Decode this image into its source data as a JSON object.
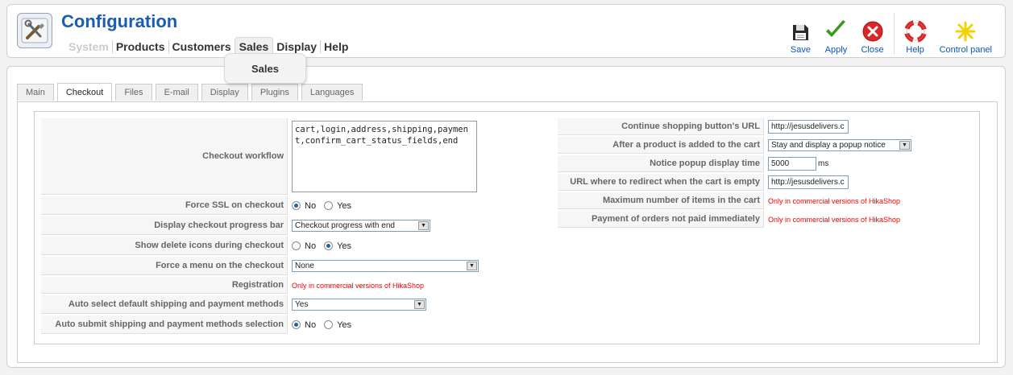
{
  "header": {
    "title": "Configuration",
    "menu": [
      {
        "label": "System",
        "state": "disabled"
      },
      {
        "label": "Products"
      },
      {
        "label": "Customers"
      },
      {
        "label": "Sales",
        "state": "active"
      },
      {
        "label": "Display"
      },
      {
        "label": "Help"
      }
    ],
    "dropdown_item": "Sales"
  },
  "toolbar": {
    "save": "Save",
    "apply": "Apply",
    "close": "Close",
    "help": "Help",
    "control_panel": "Control panel"
  },
  "tabs": [
    "Main",
    "Checkout",
    "Files",
    "E-mail",
    "Display",
    "Plugins",
    "Languages"
  ],
  "active_tab": "Checkout",
  "left_fields": {
    "checkout_workflow": {
      "label": "Checkout workflow",
      "value": "cart,login,address,shipping,payment,confirm_cart_status_fields,end"
    },
    "force_ssl": {
      "label": "Force SSL on checkout",
      "options": [
        "No",
        "Yes"
      ],
      "selected": "No"
    },
    "progress_bar": {
      "label": "Display checkout progress bar",
      "value": "Checkout progress with end"
    },
    "delete_icons": {
      "label": "Show delete icons during checkout",
      "options": [
        "No",
        "Yes"
      ],
      "selected": "Yes"
    },
    "force_menu": {
      "label": "Force a menu on the checkout",
      "value": "None"
    },
    "registration": {
      "label": "Registration",
      "value": "Only in commercial versions of HikaShop"
    },
    "auto_select": {
      "label": "Auto select default shipping and payment methods",
      "value": "Yes"
    },
    "auto_submit": {
      "label": "Auto submit shipping and payment methods selection",
      "options": [
        "No",
        "Yes"
      ],
      "selected": "No"
    }
  },
  "right_fields": {
    "continue_url": {
      "label": "Continue shopping button's URL",
      "value": "http://jesusdelivers.c"
    },
    "after_add": {
      "label": "After a product is added to the cart",
      "value": "Stay and display a popup notice"
    },
    "popup_time": {
      "label": "Notice popup display time",
      "value": "5000",
      "unit": "ms"
    },
    "empty_redirect": {
      "label": "URL where to redirect when the cart is empty",
      "value": "http://jesusdelivers.c"
    },
    "max_items": {
      "label": "Maximum number of items in the cart",
      "value": "Only in commercial versions of HikaShop"
    },
    "unpaid_orders": {
      "label": "Payment of orders not paid immediately",
      "value": "Only in commercial versions of HikaShop"
    }
  },
  "colors": {
    "title": "#1a5db5",
    "toolbar_text": "#0b55c4",
    "commercial_note": "#e00000"
  }
}
